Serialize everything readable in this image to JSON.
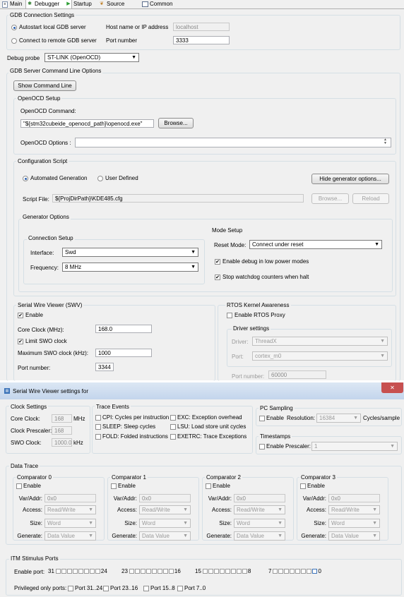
{
  "tabs": [
    {
      "label": "Main",
      "icon": "main-icon"
    },
    {
      "label": "Debugger",
      "icon": "debugger-icon"
    },
    {
      "label": "Startup",
      "icon": "startup-icon"
    },
    {
      "label": "Source",
      "icon": "source-icon"
    },
    {
      "label": "Common",
      "icon": "common-icon"
    }
  ],
  "gdb": {
    "title": "GDB Connection Settings",
    "autostart": "Autostart local GDB server",
    "connect_remote": "Connect to remote GDB server",
    "host_label": "Host name or IP address",
    "host_value": "localhost",
    "port_label": "Port number",
    "port_value": "3333"
  },
  "debug_probe": {
    "label": "Debug probe",
    "value": "ST-LINK (OpenOCD)"
  },
  "server_opts": {
    "title": "GDB Server Command Line Options",
    "show_cmd": "Show Command Line",
    "openocd_setup": "OpenOCD Setup",
    "openocd_cmd_label": "OpenOCD Command:",
    "openocd_cmd_value": "\"${stm32cubeide_openocd_path}\\openocd.exe\"",
    "browse": "Browse...",
    "openocd_options": "OpenOCD Options :"
  },
  "config_script": {
    "title": "Configuration Script",
    "automated": "Automated Generation",
    "user_defined": "User Defined",
    "hide_gen": "Hide generator options...",
    "script_file_label": "Script File:",
    "script_file_value": "${ProjDirPath}\\KDE485.cfg",
    "browse": "Browse...",
    "reload": "Reload"
  },
  "generator": {
    "title": "Generator Options",
    "conn_setup": "Connection Setup",
    "interface_label": "Interface:",
    "interface_value": "Swd",
    "frequency_label": "Frequency:",
    "frequency_value": "8 MHz",
    "mode_setup": "Mode Setup",
    "reset_mode_label": "Reset Mode:",
    "reset_mode_value": "Connect under reset",
    "low_power": "Enable debug in low power modes",
    "stop_watchdog": "Stop watchdog counters when halt"
  },
  "swv": {
    "title": "Serial Wire Viewer (SWV)",
    "enable": "Enable",
    "core_clock_label": "Core Clock (MHz):",
    "core_clock_value": "168.0",
    "limit_swo": "Limit SWO clock",
    "max_swo_label": "Maximum SWO clock (kHz):",
    "max_swo_value": "1000",
    "port_label": "Port number:",
    "port_value": "3344"
  },
  "rtos": {
    "title": "RTOS Kernel Awareness",
    "enable_proxy": "Enable RTOS Proxy",
    "driver_settings": "Driver settings",
    "driver_label": "Driver:",
    "driver_value": "ThreadX",
    "port_label": "Port:",
    "port_value": "cortex_m0",
    "portnum_label": "Port number:",
    "portnum_value": "60000"
  },
  "dialog": {
    "title": "Serial Wire Viewer settings for",
    "close": "✕",
    "clock": {
      "title": "Clock Settings",
      "core_label": "Core Clock:",
      "core_value": "168",
      "core_unit": "MHz",
      "prescaler_label": "Clock Prescaler:",
      "prescaler_value": "168",
      "swo_label": "SWO Clock:",
      "swo_value": "1000.0",
      "swo_unit": "kHz"
    },
    "trace": {
      "title": "Trace Events",
      "cpi": "CPI: Cycles per instruction",
      "sleep": "SLEEP: Sleep cycles",
      "fold": "FOLD: Folded instructions",
      "exc": "EXC: Exception overhead",
      "lsu": "LSU: Load store unit cycles",
      "exetrc": "EXETRC: Trace Exceptions"
    },
    "pc": {
      "title": "PC Sampling",
      "enable": "Enable",
      "resolution_label": "Resolution:",
      "resolution_value": "16384",
      "unit": "Cycles/sample"
    },
    "timestamps": {
      "title": "Timestamps",
      "enable": "Enable",
      "prescaler_label": "Prescaler:",
      "prescaler_value": "1"
    },
    "data_trace": {
      "title": "Data Trace",
      "comparators": [
        {
          "title": "Comparator 0",
          "enable": "Enable",
          "varaddr_label": "Var/Addr:",
          "varaddr_value": "0x0",
          "access_label": "Access:",
          "access_value": "Read/Write",
          "size_label": "Size:",
          "size_value": "Word",
          "generate_label": "Generate:",
          "generate_value": "Data Value"
        },
        {
          "title": "Comparator 1",
          "enable": "Enable",
          "varaddr_label": "Var/Addr:",
          "varaddr_value": "0x0",
          "access_label": "Access:",
          "access_value": "Read/Write",
          "size_label": "Size:",
          "size_value": "Word",
          "generate_label": "Generate:",
          "generate_value": "Data Value"
        },
        {
          "title": "Comparator 2",
          "enable": "Enable",
          "varaddr_label": "Var/Addr:",
          "varaddr_value": "0x0",
          "access_label": "Access:",
          "access_value": "Read/Write",
          "size_label": "Size:",
          "size_value": "Word",
          "generate_label": "Generate:",
          "generate_value": "Data Value"
        },
        {
          "title": "Comparator 3",
          "enable": "Enable",
          "varaddr_label": "Var/Addr:",
          "varaddr_value": "0x0",
          "access_label": "Access:",
          "access_value": "Read/Write",
          "size_label": "Size:",
          "size_value": "Word",
          "generate_label": "Generate:",
          "generate_value": "Data Value"
        }
      ]
    },
    "itm": {
      "title": "ITM Stimulus Ports",
      "enable_label": "Enable port:",
      "groups": [
        {
          "start": "31",
          "end": "24"
        },
        {
          "start": "23",
          "end": "16"
        },
        {
          "start": "15",
          "end": "8"
        },
        {
          "start": "7",
          "end": "0"
        }
      ],
      "privileged_label": "Privileged only ports:",
      "priv": [
        "Port 31..24",
        "Port 23..16",
        "Port 15..8",
        "Port 7..0"
      ]
    }
  }
}
